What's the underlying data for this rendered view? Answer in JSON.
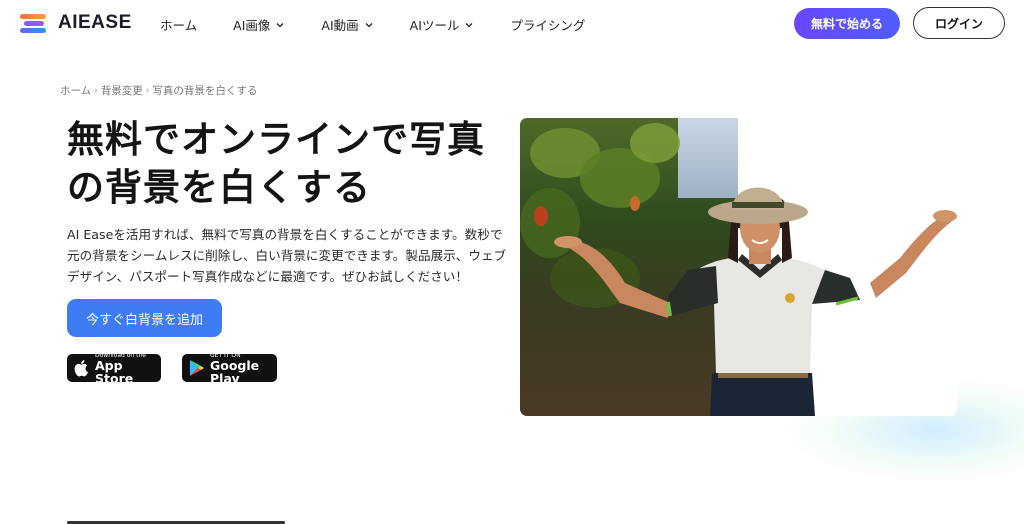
{
  "header": {
    "logo_text": "AIEASE",
    "nav": [
      {
        "label": "ホーム",
        "has_dropdown": false
      },
      {
        "label": "AI画像",
        "has_dropdown": true
      },
      {
        "label": "AI動画",
        "has_dropdown": true
      },
      {
        "label": "AIツール",
        "has_dropdown": true
      },
      {
        "label": "プライシング",
        "has_dropdown": false
      }
    ],
    "start_button": "無料で始める",
    "login_button": "ログイン"
  },
  "breadcrumb": {
    "items": [
      "ホーム",
      "背景変更",
      "写真の背景を白くする"
    ],
    "separator": "›"
  },
  "hero": {
    "title_line1": "無料でオンラインで写真",
    "title_line2": "の背景を白くする",
    "description": "AI Easeを活用すれば、無料で写真の背景を白くすることができます。数秒で元の背景をシームレスに削除し、白い背景に変更できます。製品展示、ウェブデザイン、パスポート写真作成などに最適です。ぜひお試しください！",
    "cta": "今すぐ白背景を追加"
  },
  "stores": {
    "app_store_small": "Download on the",
    "app_store_big": "App Store",
    "google_small": "GET IT ON",
    "google_big": "Google Play"
  },
  "colors": {
    "primary": "#3d7cf4",
    "start_gradient_from": "#6b46ff",
    "start_gradient_to": "#4f5dff"
  }
}
